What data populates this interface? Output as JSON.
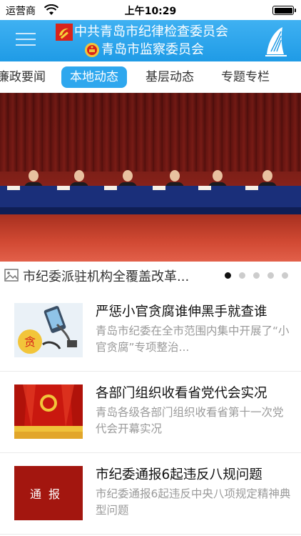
{
  "status_bar": {
    "carrier": "运营商",
    "time": "上午10:29"
  },
  "header": {
    "title_line1": "中共青岛市纪律检查委员会",
    "title_line2": "青岛市监察委员会"
  },
  "tabs": [
    {
      "label": "廉政要闻",
      "active": false
    },
    {
      "label": "本地动态",
      "active": true
    },
    {
      "label": "基层动态",
      "active": false
    },
    {
      "label": "专题专栏",
      "active": false
    }
  ],
  "banner": {
    "caption": "市纪委派驻机构全覆盖改革...",
    "slides_total": 5,
    "active_slide": 1
  },
  "news": [
    {
      "title": "严惩小官贪腐谁伸黑手就查谁",
      "summary": "青岛市纪委在全市范围内集中开展了“小官贪腐”专项整治..."
    },
    {
      "title": "各部门组织收看省党代会实况",
      "summary": "青岛各级各部门组织收看省第十一次党代会开幕实况"
    },
    {
      "title": "市纪委通报6起违反八规问题",
      "summary": "市纪委通报6起违反中央八项规定精神典型问题",
      "thumb_text": "通报"
    }
  ],
  "thumb1_text": "贪",
  "colors": {
    "header": "#1f9be6",
    "active_tab": "#2ea7ee",
    "active_dot": "#111111"
  }
}
